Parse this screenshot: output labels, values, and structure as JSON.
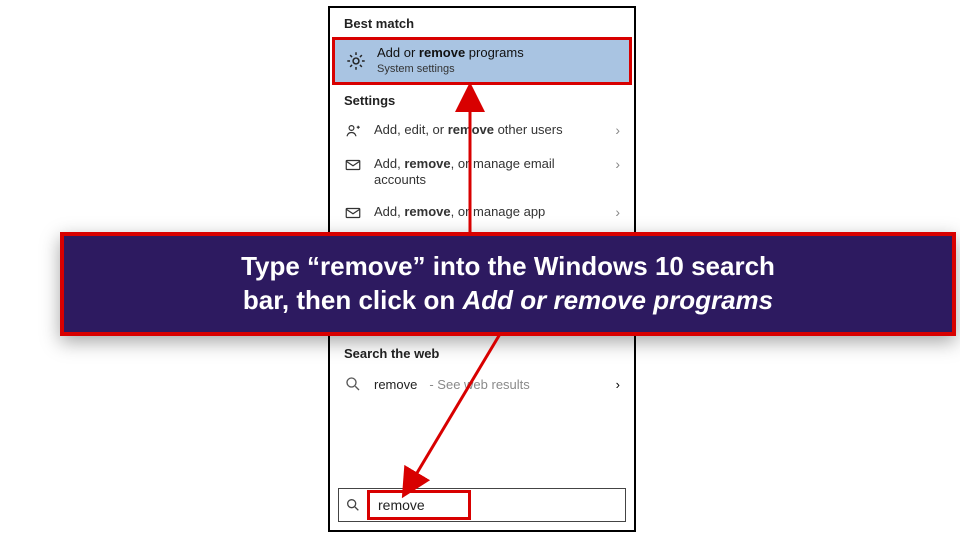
{
  "panel": {
    "best_match_header": "Best match",
    "best_match": {
      "title_pre": "Add or ",
      "title_kw": "remove",
      "title_post": " programs",
      "subtitle": "System settings"
    },
    "settings_header": "Settings",
    "settings_items": [
      {
        "pre": "Add, edit, or ",
        "kw": "remove",
        "post": " other users"
      },
      {
        "pre": "Add, ",
        "kw": "remove",
        "post": ", or manage email accounts"
      },
      {
        "pre": "Add, ",
        "kw": "remove",
        "post": ", or manage app"
      }
    ],
    "web_header": "Search the web",
    "web_item": {
      "query": "remove",
      "hint": " - See web results"
    },
    "search_value": "remove"
  },
  "callout": {
    "line1": "Type “remove” into the Windows 10 search",
    "line2_pre": "bar, then click on ",
    "line2_ital": "Add or remove programs"
  }
}
